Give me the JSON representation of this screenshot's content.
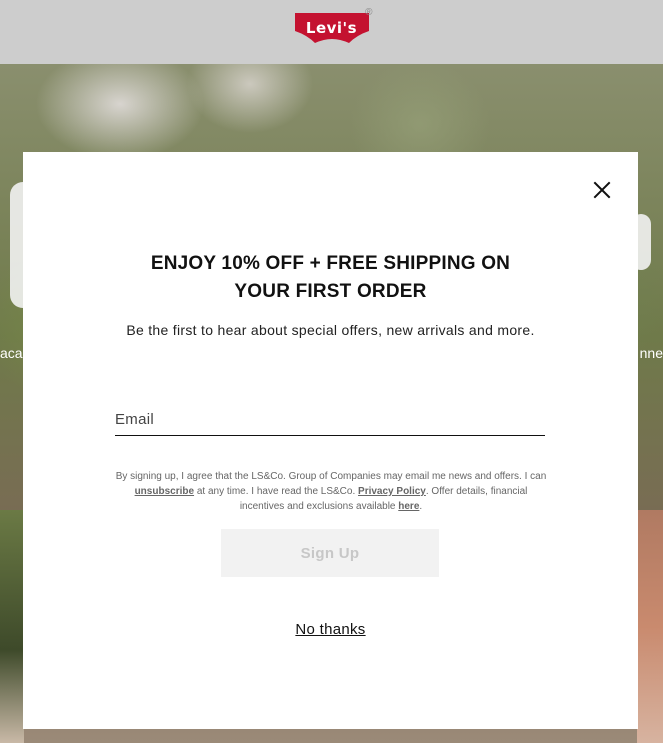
{
  "header": {
    "logo_text": "Levi's",
    "logo_mark": "®",
    "logo_color": "#c41230"
  },
  "background": {
    "caption_left": "aca",
    "caption_right": "nne"
  },
  "modal": {
    "title_line1": "ENJOY 10% OFF + FREE SHIPPING ON",
    "title_line2": "YOUR FIRST ORDER",
    "subtitle": "Be the first to hear about special offers, new arrivals and more.",
    "email_placeholder": "Email",
    "email_value": "",
    "legal": {
      "part1": "By signing up, I agree that the LS&Co. Group of Companies may email me news and offers. I can ",
      "unsubscribe_link": "unsubscribe",
      "part2": " at any time. I have read the LS&Co. ",
      "privacy_link": "Privacy Policy",
      "part3": ". Offer details, financial incentives and exclusions available ",
      "here_link": "here",
      "part4": "."
    },
    "signup_label": "Sign Up",
    "no_thanks_label": "No thanks",
    "close_icon": "close-icon"
  }
}
